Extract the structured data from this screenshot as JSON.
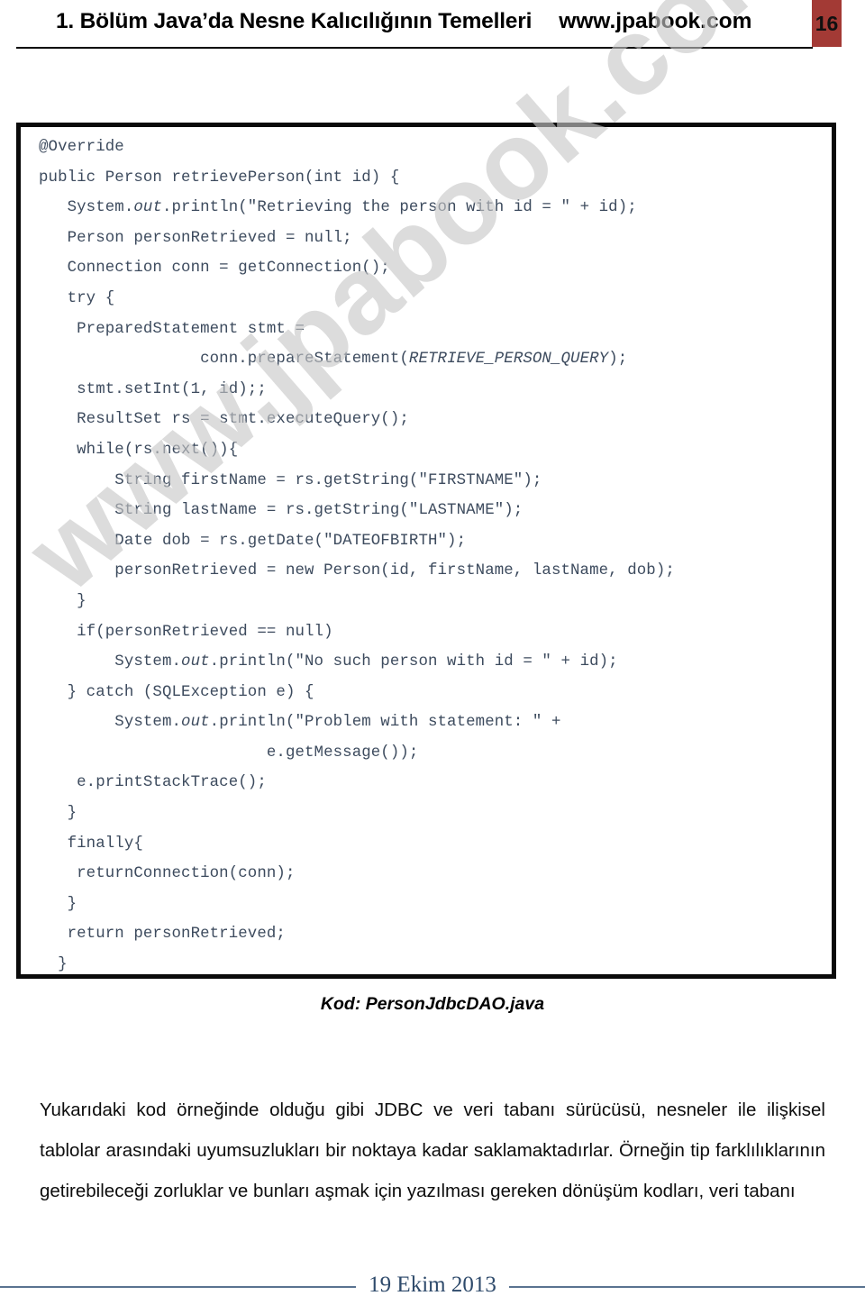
{
  "header": {
    "title": "1. Bölüm Java’da Nesne Kalıcılığının Temelleri",
    "site": "www.jpabook.com",
    "page_number": "16",
    "badge_color": "#a33a35"
  },
  "watermark": {
    "text": "www.jpabook.com",
    "color": "#c8c8c8"
  },
  "code": {
    "language": "java",
    "text_color": "#3d4b5e",
    "border_color": "#0a0a0a",
    "lines": [
      "@Override",
      "public Person retrievePerson(int id) {",
      "   System.<i>out</i>.println(\"Retrieving the person with id = \" + id);",
      "   Person personRetrieved = null;",
      "   Connection conn = getConnection();",
      "   try {",
      "    PreparedStatement stmt =",
      "                 conn.prepareStatement(<i>RETRIEVE_PERSON_QUERY</i>);",
      "    stmt.setInt(1, id);;",
      "    ResultSet rs = stmt.executeQuery();",
      "    while(rs.next()){",
      "        String firstName = rs.getString(\"FIRSTNAME\");",
      "        String lastName = rs.getString(\"LASTNAME\");",
      "        Date dob = rs.getDate(\"DATEOFBIRTH\");",
      "        personRetrieved = new Person(id, firstName, lastName, dob);",
      "    }",
      "    if(personRetrieved == null)",
      "        System.<i>out</i>.println(\"No such person with id = \" + id);",
      "   } catch (SQLException e) {",
      "        System.<i>out</i>.println(\"Problem with statement: \" +",
      "                        e.getMessage());",
      "    e.printStackTrace();",
      "   }",
      "   finally{",
      "    returnConnection(conn);",
      "   }",
      "   return personRetrieved;",
      "  }"
    ]
  },
  "caption": {
    "text": "Kod: PersonJdbcDAO.java"
  },
  "body": {
    "paragraph": "Yukarıdaki kod örneğinde olduğu gibi JDBC ve veri tabanı sürücüsü, nesneler ile ilişkisel tablolar arasındaki uyumsuzlukları bir noktaya kadar saklamaktadırlar. Örneğin tip farklılıklarının getirebileceği zorluklar ve bunları aşmak için yazılması gereken dönüşüm kodları, veri tabanı"
  },
  "footer": {
    "date": "19 Ekim 2013",
    "line_color": "#5a7390"
  }
}
